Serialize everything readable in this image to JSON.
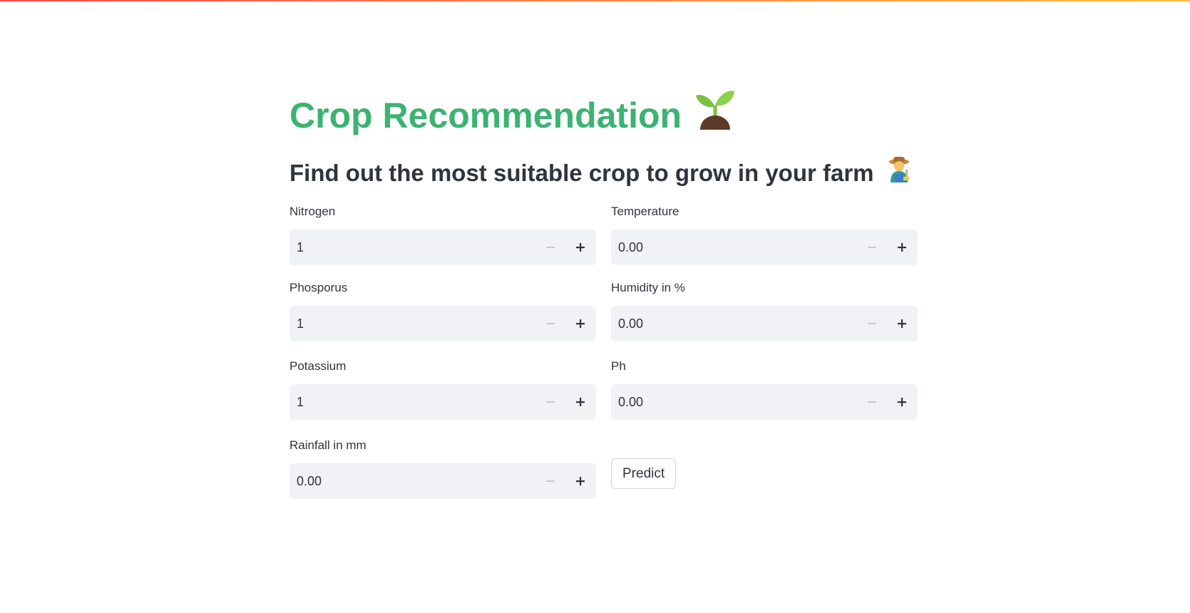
{
  "colors": {
    "title": "#3cb371",
    "text": "#31333f",
    "input_bg": "#f0f2f6",
    "stripe_start": "#ff4b4b",
    "stripe_end": "#ffbd45"
  },
  "header": {
    "title": "Crop Recommendation",
    "title_icon": "seedling-icon",
    "subtitle": "Find out the most suitable crop to grow in your farm",
    "subtitle_icon": "farmer-icon"
  },
  "form": {
    "nitrogen": {
      "label": "Nitrogen",
      "value": "1"
    },
    "phosporus": {
      "label": "Phosporus",
      "value": "1"
    },
    "potassium": {
      "label": "Potassium",
      "value": "1"
    },
    "rainfall": {
      "label": "Rainfall in mm",
      "value": "0.00"
    },
    "temperature": {
      "label": "Temperature",
      "value": "0.00"
    },
    "humidity": {
      "label": "Humidity in %",
      "value": "0.00"
    },
    "ph": {
      "label": "Ph",
      "value": "0.00"
    },
    "stepper_icons": [
      "minus-icon",
      "plus-icon"
    ],
    "predict_label": "Predict"
  }
}
